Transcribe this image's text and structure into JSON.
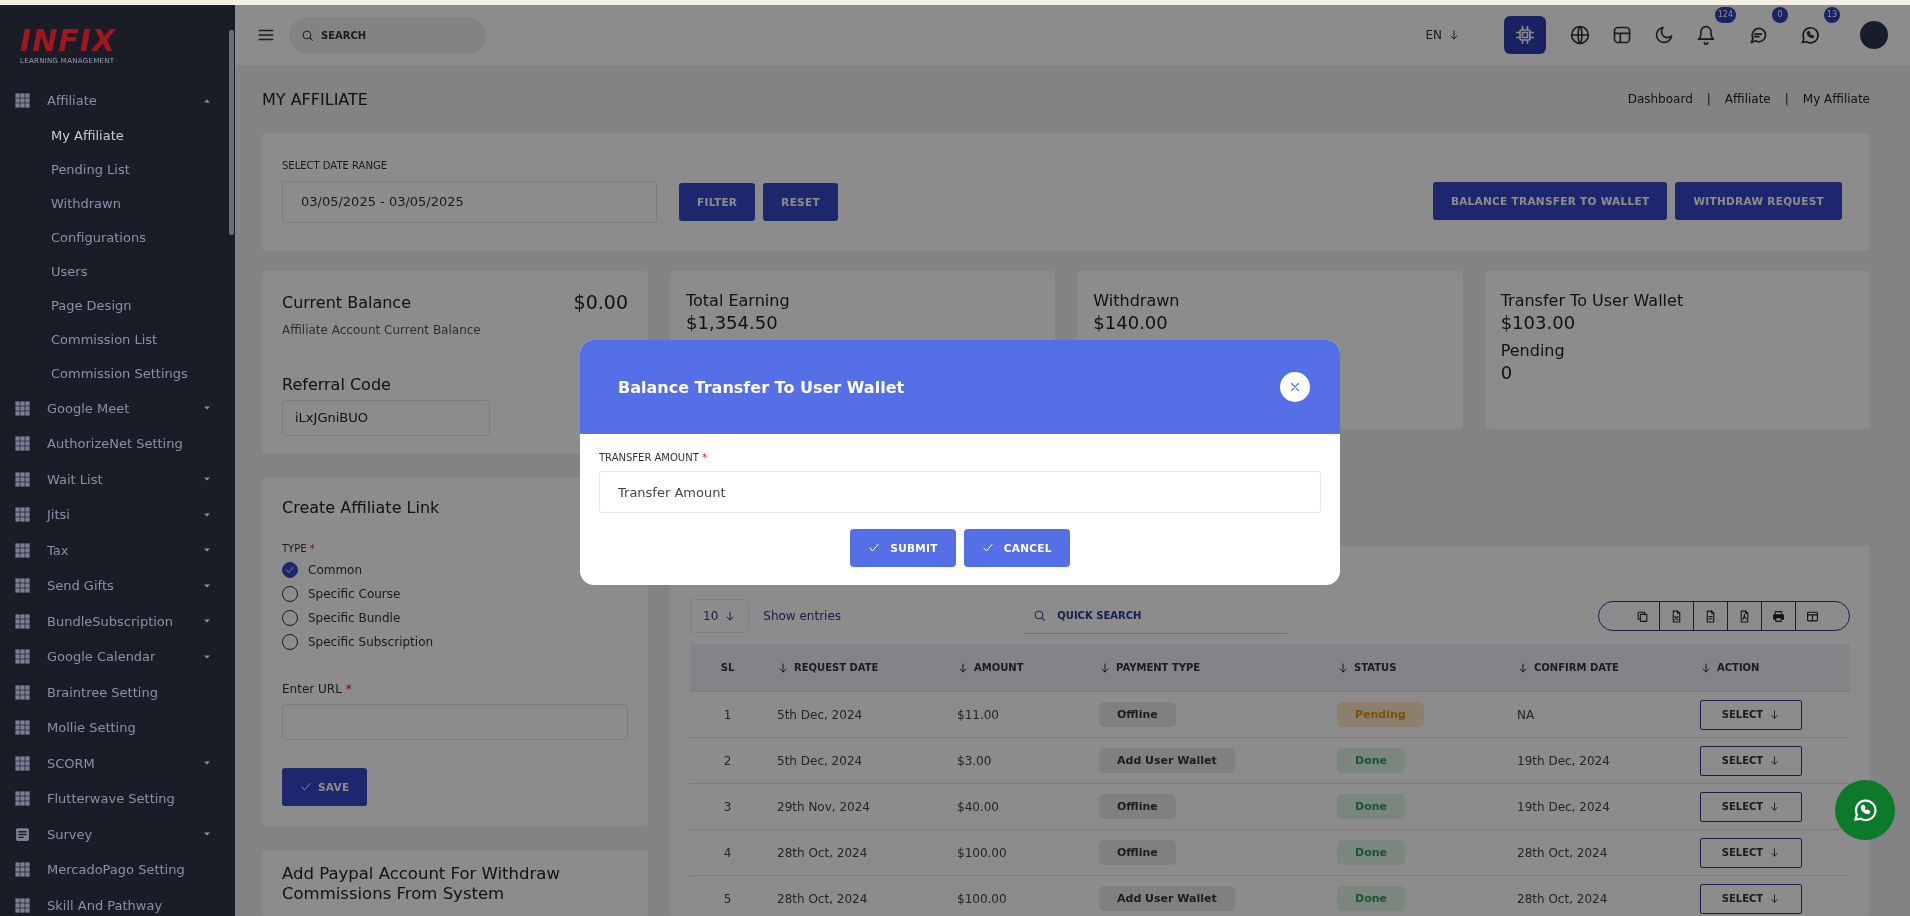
{
  "sidebar": {
    "logo": {
      "name": "INFIX",
      "tagline": "LEARNING MANAGEMENT"
    },
    "items": [
      {
        "label": "Affiliate",
        "kind": "grid-group",
        "expanded": true,
        "children": [
          {
            "label": "My Affiliate",
            "selected": true
          },
          {
            "label": "Pending List",
            "selected": false
          },
          {
            "label": "Withdrawn",
            "selected": false
          },
          {
            "label": "Configurations",
            "selected": false
          },
          {
            "label": "Users",
            "selected": false
          },
          {
            "label": "Page Design",
            "selected": false
          },
          {
            "label": "Commission List",
            "selected": false
          },
          {
            "label": "Commission Settings",
            "selected": false
          }
        ]
      },
      {
        "label": "Google Meet",
        "kind": "grid-group",
        "expanded": false
      },
      {
        "label": "AuthorizeNet Setting",
        "kind": "grid-link"
      },
      {
        "label": "Wait List",
        "kind": "grid-group",
        "expanded": false
      },
      {
        "label": "Jitsi",
        "kind": "grid-group",
        "expanded": false
      },
      {
        "label": "Tax",
        "kind": "grid-group",
        "expanded": false
      },
      {
        "label": "Send Gifts",
        "kind": "grid-group",
        "expanded": false
      },
      {
        "label": "BundleSubscription",
        "kind": "grid-group",
        "expanded": false
      },
      {
        "label": "Google Calendar",
        "kind": "grid-group",
        "expanded": false
      },
      {
        "label": "Braintree Setting",
        "kind": "grid-link"
      },
      {
        "label": "Mollie Setting",
        "kind": "grid-link"
      },
      {
        "label": "SCORM",
        "kind": "grid-group",
        "expanded": false
      },
      {
        "label": "Flutterwave Setting",
        "kind": "grid-link"
      },
      {
        "label": "Survey",
        "kind": "form-group",
        "expanded": false
      },
      {
        "label": "MercadoPago Setting",
        "kind": "grid-link"
      },
      {
        "label": "Skill And Pathway",
        "kind": "grid-link"
      }
    ]
  },
  "topbar": {
    "search": {
      "placeholder": "SEARCH"
    },
    "language": "EN",
    "alerts": [
      {
        "kind": "bell",
        "count": "124"
      },
      {
        "kind": "chat",
        "count": "0"
      },
      {
        "kind": "whatsapp",
        "count": "13"
      }
    ]
  },
  "page": {
    "title": "MY AFFILIATE",
    "separator": "|",
    "breadcrumb": [
      "Dashboard",
      "Affiliate",
      "My Affiliate"
    ]
  },
  "filter": {
    "label": "SELECT DATE RANGE",
    "value": "03/05/2025 - 03/05/2025",
    "buttons": [
      "FILTER",
      "RESET"
    ],
    "actions": [
      "BALANCE TRANSFER TO WALLET",
      "WITHDRAW REQUEST"
    ]
  },
  "balance": {
    "title": "Current Balance",
    "amount": "$0.00",
    "subtitle": "Affiliate Account Current Balance",
    "referral_title": "Referral Code",
    "referral_code": "iLxJGniBUO"
  },
  "stats": [
    {
      "title": "Total Earning",
      "value": "$1,354.50"
    },
    {
      "title": "Withdrawn",
      "value": "$140.00"
    },
    {
      "title": "Transfer To User Wallet",
      "value": "$103.00",
      "extra_title": "Pending",
      "extra_value": "0"
    }
  ],
  "affiliate_link": {
    "title": "Create Affiliate Link",
    "type_label": "TYPE",
    "required": "*",
    "options": [
      {
        "label": "Common",
        "selected": true
      },
      {
        "label": "Specific Course",
        "selected": false
      },
      {
        "label": "Specific Bundle",
        "selected": false
      },
      {
        "label": "Specific Subscription",
        "selected": false
      }
    ],
    "url_label": "Enter URL",
    "save": "SAVE"
  },
  "paypal": {
    "title": "Add Paypal Account For Withdraw Commissions From System"
  },
  "table": {
    "page_size": "10",
    "show_entries": "Show entries",
    "search_placeholder": "QUICK SEARCH",
    "columns": [
      {
        "label": "SL",
        "sortable": false
      },
      {
        "label": "REQUEST DATE",
        "sortable": true
      },
      {
        "label": "AMOUNT",
        "sortable": true
      },
      {
        "label": "PAYMENT TYPE",
        "sortable": true
      },
      {
        "label": "STATUS",
        "sortable": true
      },
      {
        "label": "CONFIRM DATE",
        "sortable": true
      },
      {
        "label": "ACTION",
        "sortable": true
      }
    ],
    "rows": [
      {
        "sl": "1",
        "request_date": "5th Dec, 2024",
        "amount": "$11.00",
        "payment_type": "Offline",
        "status": {
          "text": "Pending",
          "kind": "pending"
        },
        "confirm_date": "NA",
        "action": "SELECT"
      },
      {
        "sl": "2",
        "request_date": "5th Dec, 2024",
        "amount": "$3.00",
        "payment_type": "Add User Wallet",
        "status": {
          "text": "Done",
          "kind": "done"
        },
        "confirm_date": "19th Dec, 2024",
        "action": "SELECT"
      },
      {
        "sl": "3",
        "request_date": "29th Nov, 2024",
        "amount": "$40.00",
        "payment_type": "Offline",
        "status": {
          "text": "Done",
          "kind": "done"
        },
        "confirm_date": "19th Dec, 2024",
        "action": "SELECT"
      },
      {
        "sl": "4",
        "request_date": "28th Oct, 2024",
        "amount": "$100.00",
        "payment_type": "Offline",
        "status": {
          "text": "Done",
          "kind": "done"
        },
        "confirm_date": "28th Oct, 2024",
        "action": "SELECT"
      },
      {
        "sl": "5",
        "request_date": "28th Oct, 2024",
        "amount": "$100.00",
        "payment_type": "Add User Wallet",
        "status": {
          "text": "Done",
          "kind": "done"
        },
        "confirm_date": "28th Oct, 2024",
        "action": "SELECT"
      }
    ]
  },
  "modal": {
    "title": "Balance Transfer To User Wallet",
    "field_label": "TRANSFER AMOUNT",
    "required": "*",
    "placeholder": "Transfer Amount",
    "buttons": [
      "SUBMIT",
      "CANCEL"
    ]
  }
}
